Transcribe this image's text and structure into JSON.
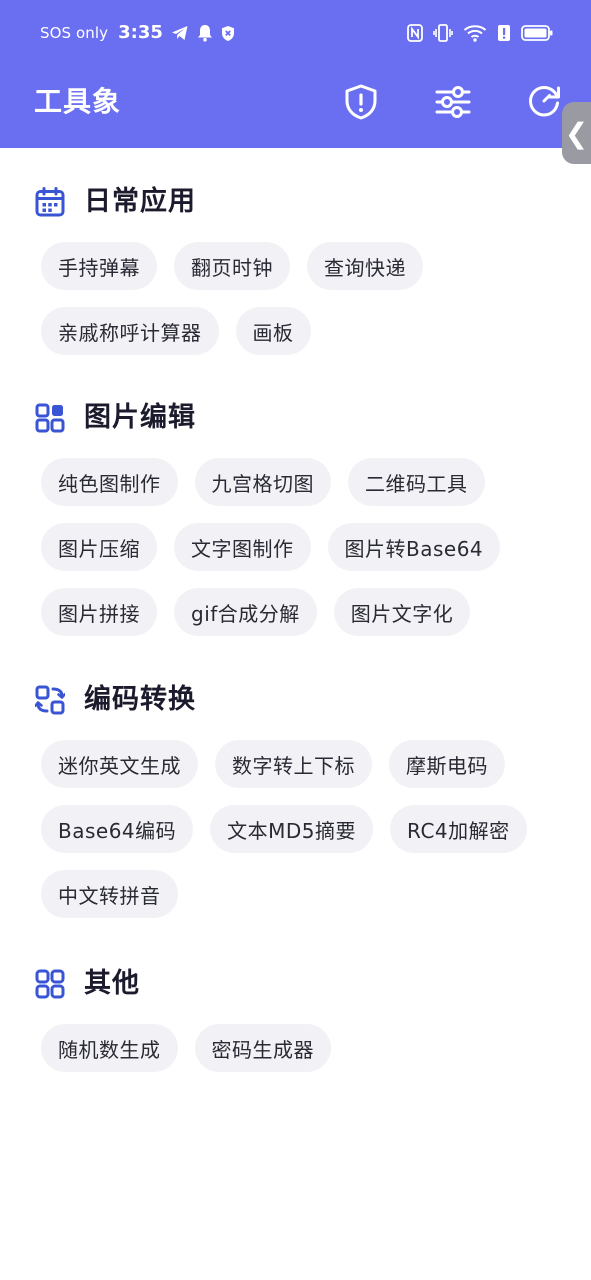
{
  "status_bar": {
    "sos": "SOS only",
    "time": "3:35"
  },
  "app_bar": {
    "title": "工具象"
  },
  "side_handle": {
    "glyph": "❮"
  },
  "sections": [
    {
      "title": "日常应用",
      "icon": "calendar-icon",
      "items": [
        "手持弹幕",
        "翻页时钟",
        "查询快递",
        "亲戚称呼计算器",
        "画板"
      ]
    },
    {
      "title": "图片编辑",
      "icon": "grid-icon",
      "items": [
        "纯色图制作",
        "九宫格切图",
        "二维码工具",
        "图片压缩",
        "文字图制作",
        "图片转Base64",
        "图片拼接",
        "gif合成分解",
        "图片文字化"
      ]
    },
    {
      "title": "编码转换",
      "icon": "convert-icon",
      "items": [
        "迷你英文生成",
        "数字转上下标",
        "摩斯电码",
        "Base64编码",
        "文本MD5摘要",
        "RC4加解密",
        "中文转拼音"
      ]
    },
    {
      "title": "其他",
      "icon": "apps-icon",
      "items": [
        "随机数生成",
        "密码生成器"
      ]
    }
  ],
  "colors": {
    "header_bg": "#6a6ff1",
    "accent_icon": "#3a55d4",
    "chip_bg": "#f2f2f6"
  }
}
